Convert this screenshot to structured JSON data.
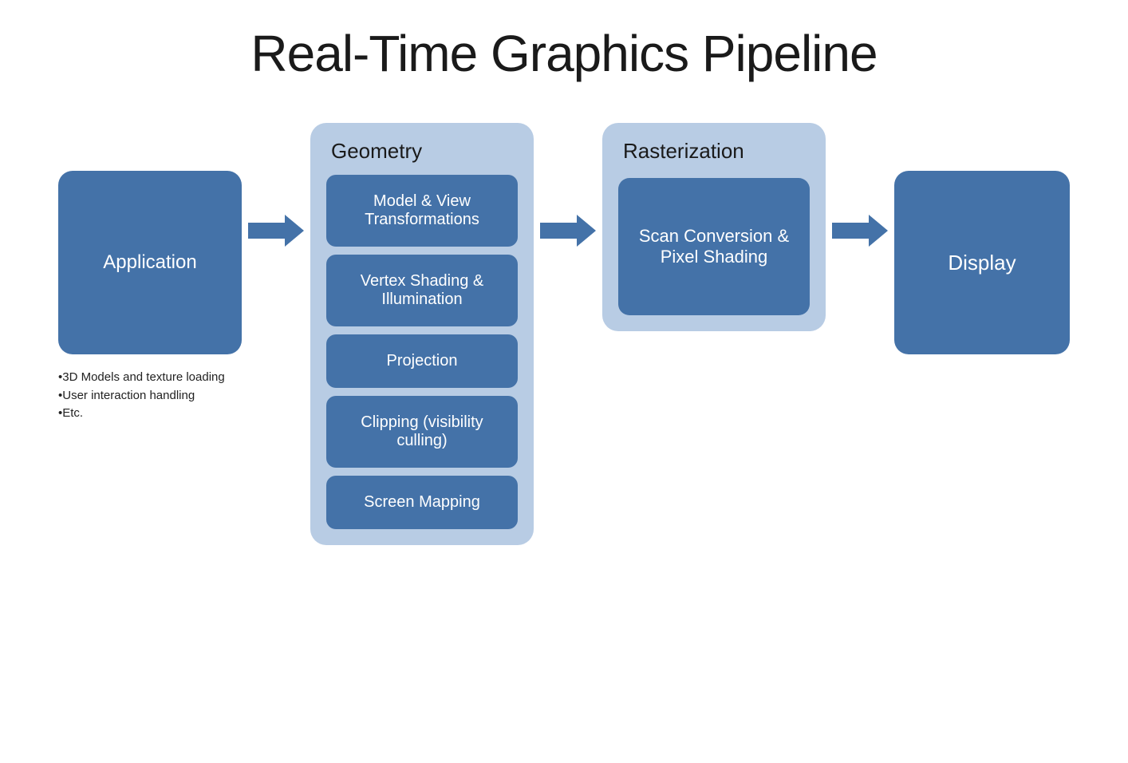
{
  "title": "Real-Time Graphics Pipeline",
  "application": {
    "label": "Application",
    "notes": [
      "•3D Models and texture loading",
      "•User interaction handling",
      "•Etc."
    ]
  },
  "geometry": {
    "group_label": "Geometry",
    "stages": [
      "Model & View Transformations",
      "Vertex Shading & Illumination",
      "Projection",
      "Clipping (visibility culling)",
      "Screen Mapping"
    ]
  },
  "rasterization": {
    "group_label": "Rasterization",
    "stage": "Scan Conversion & Pixel Shading"
  },
  "display": {
    "label": "Display"
  }
}
